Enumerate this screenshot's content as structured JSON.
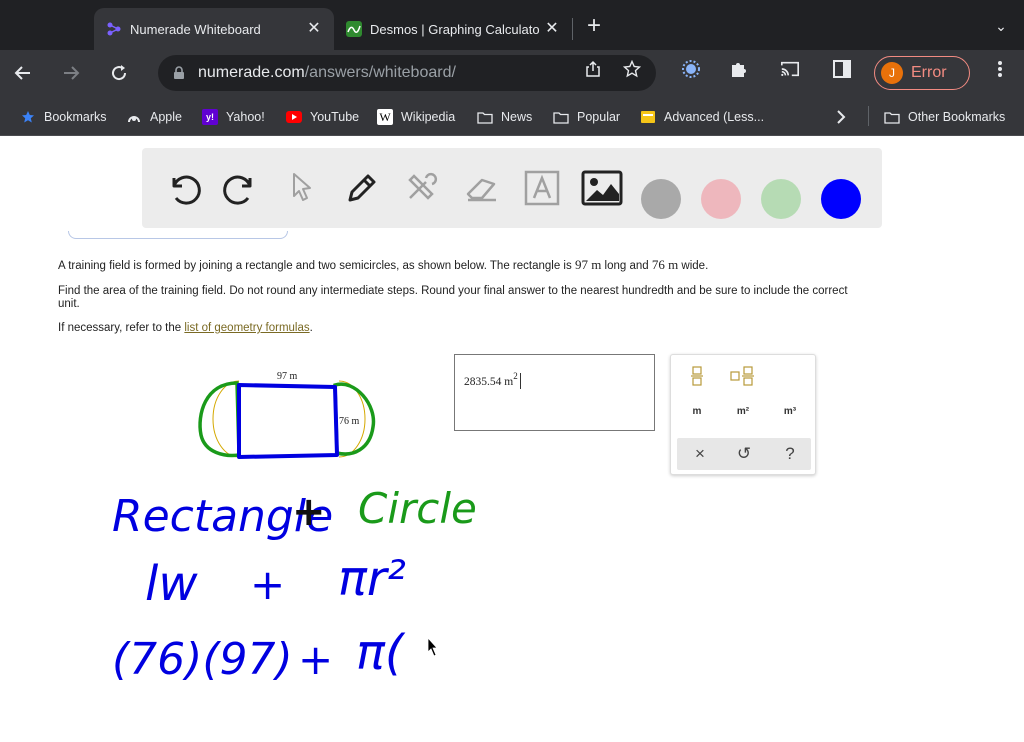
{
  "tabs": [
    {
      "title": "Numerade Whiteboard",
      "active": true
    },
    {
      "title": "Desmos | Graphing Calculato",
      "active": false
    }
  ],
  "url": {
    "domain": "numerade.com",
    "path": "/answers/whiteboard/"
  },
  "profile": {
    "initial": "J",
    "status": "Error"
  },
  "bookmarks": [
    {
      "label": "Bookmarks",
      "icon": "star-icon"
    },
    {
      "label": "Apple",
      "icon": "apple-icon"
    },
    {
      "label": "Yahoo!",
      "icon": "yahoo-icon"
    },
    {
      "label": "YouTube",
      "icon": "youtube-icon"
    },
    {
      "label": "Wikipedia",
      "icon": "wikipedia-icon"
    },
    {
      "label": "News",
      "icon": "folder-icon"
    },
    {
      "label": "Popular",
      "icon": "folder-icon"
    },
    {
      "label": "Advanced (Less...",
      "icon": "bookmark-page-icon"
    },
    {
      "label": "Other Bookmarks",
      "icon": "folder-icon"
    }
  ],
  "whiteboard": {
    "tools": [
      "undo-icon",
      "redo-icon",
      "select-icon",
      "pen-icon",
      "tools-icon",
      "eraser-icon",
      "text-icon",
      "image-icon"
    ],
    "colors": [
      "#a9a9a9",
      "#eeb7bd",
      "#b6dbb4",
      "#0000ff"
    ]
  },
  "question": {
    "line1_pre": "A training field is formed by joining a rectangle and two semicircles, as shown below. The rectangle is",
    "length": "97 m",
    "line1_mid": "long and",
    "width": "76 m",
    "line1_post": "wide.",
    "line2a": "Find the area of the training field. Do not round any intermediate steps. Round your final answer to the nearest hundredth and be sure to include the correct",
    "line2b": "unit.",
    "line3_pre": "If necessary, refer to the",
    "link": "list of geometry formulas",
    "line3_post": "."
  },
  "figure": {
    "length_label": "97 m",
    "width_label": "76 m"
  },
  "answer": {
    "value": "2835.54 m",
    "exponent": "2"
  },
  "unit_pad": {
    "units": [
      "m",
      "m²",
      "m³"
    ],
    "actions": [
      "×",
      "↺",
      "?"
    ]
  },
  "handwriting": {
    "line1": [
      "Rectangle",
      "+",
      "Circle"
    ],
    "line2": [
      "lw",
      "+",
      "πr²"
    ],
    "line3": [
      "(76)(97)",
      "+",
      "π("
    ]
  },
  "colors": {
    "ink_blue": "#0000e0",
    "ink_green": "#1a9a1a",
    "link": "#7a6a24"
  }
}
